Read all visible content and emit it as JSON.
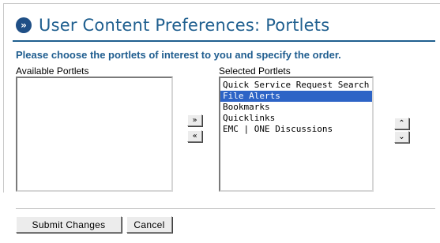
{
  "page": {
    "title": "User Content Preferences: Portlets",
    "title_icon": "double-chevron-right-icon",
    "instructions": "Please choose the portlets of interest to you and specify the order."
  },
  "available": {
    "label": "Available Portlets",
    "items": []
  },
  "selected": {
    "label": "Selected Portlets",
    "items": [
      "Quick Service Request Search",
      "File Alerts",
      "Bookmarks",
      "Quicklinks",
      "EMC | ONE Discussions"
    ],
    "highlighted": "File Alerts"
  },
  "buttons": {
    "add": "»",
    "remove": "«",
    "move_up": "⌃",
    "move_down": "⌄",
    "submit": "Submit Changes",
    "cancel": "Cancel"
  },
  "colors": {
    "title": "#1f5f8f",
    "selection": "#2d64c6"
  }
}
